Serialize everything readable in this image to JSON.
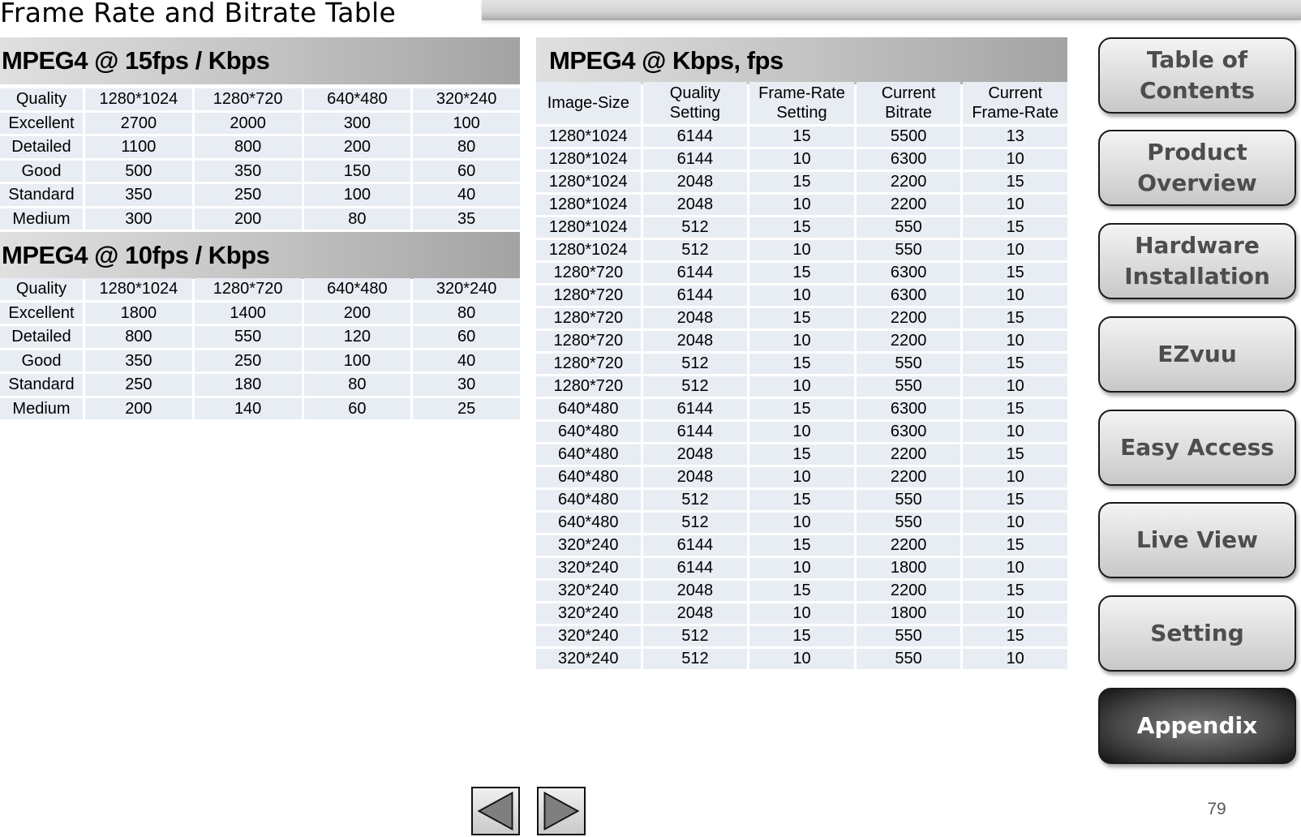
{
  "page": {
    "title": "Frame Rate and Bitrate Table",
    "page_number": "79"
  },
  "table_15fps": {
    "title": "MPEG4 @ 15fps / Kbps",
    "headers": [
      "Quality",
      "1280*1024",
      "1280*720",
      "640*480",
      "320*240"
    ],
    "rows": [
      [
        "Excellent",
        "2700",
        "2000",
        "300",
        "100"
      ],
      [
        "Detailed",
        "1100",
        "800",
        "200",
        "80"
      ],
      [
        "Good",
        "500",
        "350",
        "150",
        "60"
      ],
      [
        "Standard",
        "350",
        "250",
        "100",
        "40"
      ],
      [
        "Medium",
        "300",
        "200",
        "80",
        "35"
      ]
    ]
  },
  "table_10fps": {
    "title": "MPEG4 @ 10fps / Kbps",
    "headers": [
      "Quality",
      "1280*1024",
      "1280*720",
      "640*480",
      "320*240"
    ],
    "rows": [
      [
        "Excellent",
        "1800",
        "1400",
        "200",
        "80"
      ],
      [
        "Detailed",
        "800",
        "550",
        "120",
        "60"
      ],
      [
        "Good",
        "350",
        "250",
        "100",
        "40"
      ],
      [
        "Standard",
        "250",
        "180",
        "80",
        "30"
      ],
      [
        "Medium",
        "200",
        "140",
        "60",
        "25"
      ]
    ]
  },
  "table_kbps_fps": {
    "title": "MPEG4 @ Kbps, fps",
    "headers": [
      [
        "Image-Size"
      ],
      [
        "Quality",
        "Setting"
      ],
      [
        "Frame-Rate",
        "Setting"
      ],
      [
        "Current",
        "Bitrate"
      ],
      [
        "Current",
        "Frame-Rate"
      ]
    ],
    "rows": [
      [
        "1280*1024",
        "6144",
        "15",
        "5500",
        "13"
      ],
      [
        "1280*1024",
        "6144",
        "10",
        "6300",
        "10"
      ],
      [
        "1280*1024",
        "2048",
        "15",
        "2200",
        "15"
      ],
      [
        "1280*1024",
        "2048",
        "10",
        "2200",
        "10"
      ],
      [
        "1280*1024",
        "512",
        "15",
        "550",
        "15"
      ],
      [
        "1280*1024",
        "512",
        "10",
        "550",
        "10"
      ],
      [
        "1280*720",
        "6144",
        "15",
        "6300",
        "15"
      ],
      [
        "1280*720",
        "6144",
        "10",
        "6300",
        "10"
      ],
      [
        "1280*720",
        "2048",
        "15",
        "2200",
        "15"
      ],
      [
        "1280*720",
        "2048",
        "10",
        "2200",
        "10"
      ],
      [
        "1280*720",
        "512",
        "15",
        "550",
        "15"
      ],
      [
        "1280*720",
        "512",
        "10",
        "550",
        "10"
      ],
      [
        "640*480",
        "6144",
        "15",
        "6300",
        "15"
      ],
      [
        "640*480",
        "6144",
        "10",
        "6300",
        "10"
      ],
      [
        "640*480",
        "2048",
        "15",
        "2200",
        "15"
      ],
      [
        "640*480",
        "2048",
        "10",
        "2200",
        "10"
      ],
      [
        "640*480",
        "512",
        "15",
        "550",
        "15"
      ],
      [
        "640*480",
        "512",
        "10",
        "550",
        "10"
      ],
      [
        "320*240",
        "6144",
        "15",
        "2200",
        "15"
      ],
      [
        "320*240",
        "6144",
        "10",
        "1800",
        "10"
      ],
      [
        "320*240",
        "2048",
        "15",
        "2200",
        "15"
      ],
      [
        "320*240",
        "2048",
        "10",
        "1800",
        "10"
      ],
      [
        "320*240",
        "512",
        "15",
        "550",
        "15"
      ],
      [
        "320*240",
        "512",
        "10",
        "550",
        "10"
      ]
    ]
  },
  "nav": {
    "items": [
      {
        "label": "Table of\nContents",
        "active": false
      },
      {
        "label": "Product\nOverview",
        "active": false
      },
      {
        "label": "Hardware\nInstallation",
        "active": false
      },
      {
        "label": "EZvuu",
        "active": false
      },
      {
        "label": "Easy Access",
        "active": false
      },
      {
        "label": "Live View",
        "active": false
      },
      {
        "label": "Setting",
        "active": false
      },
      {
        "label": "Appendix",
        "active": true
      }
    ],
    "prev_icon": "triangle-left-icon",
    "next_icon": "triangle-right-icon"
  },
  "colors": {
    "cell_bg": "#e8ecf3",
    "active_nav_text": "#ffffff",
    "nav_text": "#4d4d4d"
  }
}
